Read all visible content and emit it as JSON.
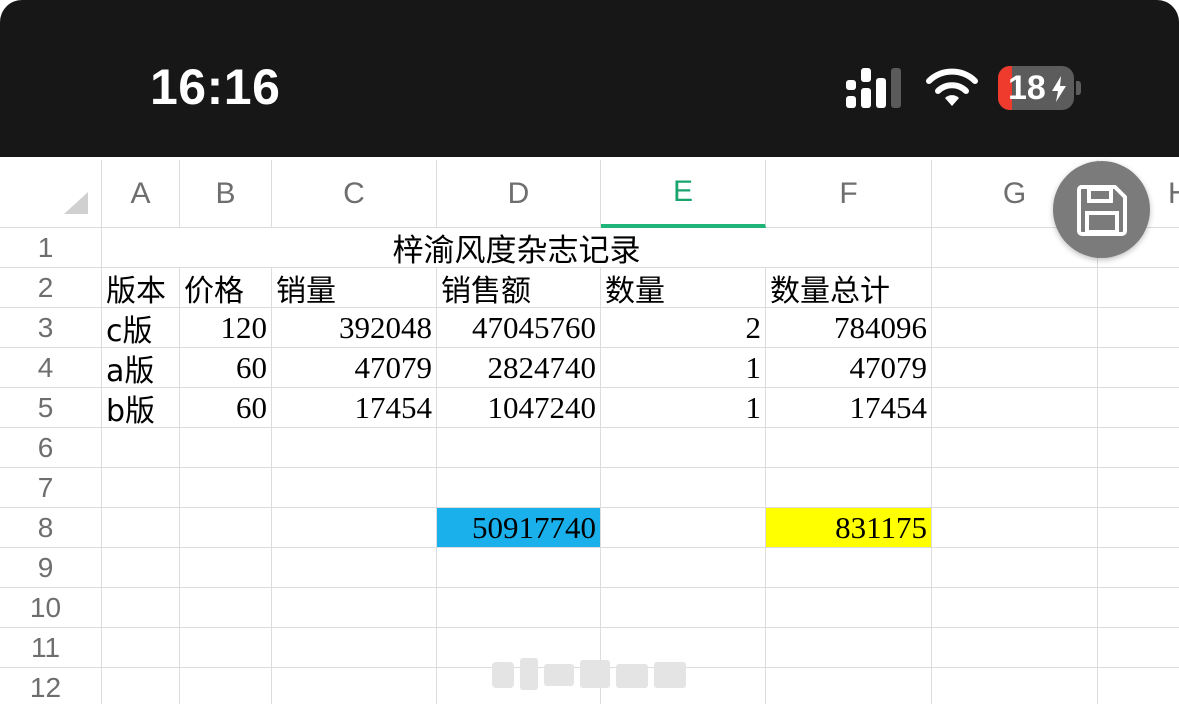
{
  "status_bar": {
    "time": "16:16",
    "battery_level": "18",
    "battery_fraction": 0.18,
    "battery_color": "#ef3b2d",
    "icons": [
      "signal-icon",
      "wifi-icon",
      "battery-charging-icon"
    ]
  },
  "sheet": {
    "columns": [
      "A",
      "B",
      "C",
      "D",
      "E",
      "F",
      "G",
      "H"
    ],
    "active_column": "E",
    "rows": [
      "1",
      "2",
      "3",
      "4",
      "5",
      "6",
      "7",
      "8",
      "9",
      "10",
      "11",
      "12"
    ],
    "title": "梓渝风度杂志记录",
    "headers": {
      "a": "版本",
      "b": "价格",
      "c": "销量",
      "d": "销售额",
      "e": "数量",
      "f": "数量总计"
    },
    "data_rows": [
      {
        "a": "c版",
        "b": "120",
        "c": "392048",
        "d": "47045760",
        "e": "2",
        "f": "784096"
      },
      {
        "a": "a版",
        "b": "60",
        "c": "47079",
        "d": "2824740",
        "e": "1",
        "f": "47079"
      },
      {
        "a": "b版",
        "b": "60",
        "c": "17454",
        "d": "1047240",
        "e": "1",
        "f": "17454"
      }
    ],
    "totals": {
      "d": "50917740",
      "f": "831175"
    },
    "highlight_colors": {
      "d_total": "#1ab0ec",
      "f_total": "#ffff00",
      "active_column": "#1fb478"
    }
  },
  "toolbar": {
    "save_icon": "floppy-disk-icon"
  }
}
